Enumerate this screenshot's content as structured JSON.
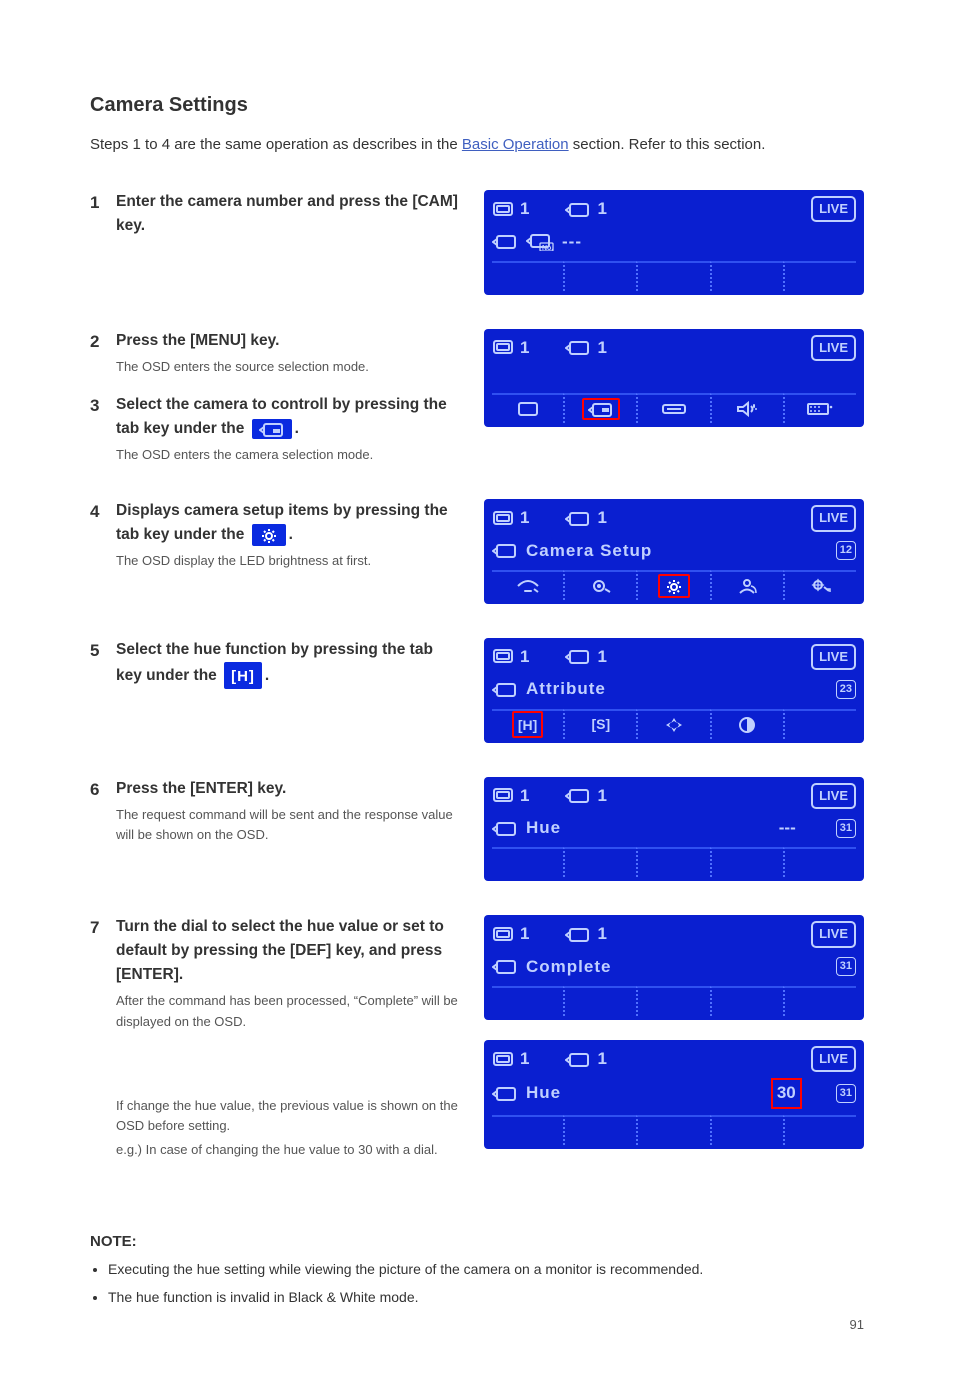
{
  "header": "Camera Settings",
  "intro": {
    "steps": "Steps 1 to 4 are the same operation as describes in the ",
    "link": "Basic Operation",
    "post": " section. Refer to this section."
  },
  "steps": [
    {
      "n": "1",
      "label": "Enter the camera number and press the [CAM] key.",
      "sub": ""
    },
    {
      "n": "2",
      "label": "Press the [MENU] key.",
      "sub": "The OSD enters the source selection mode."
    },
    {
      "n": "3",
      "label": "Select the camera to controll by pressing the tab key under the ",
      "sub": "The OSD enters the camera selection mode.",
      "inlineIcon": "camera"
    },
    {
      "n": "4",
      "label": "Displays camera setup items by pressing the tab key under the ",
      "sub": "The OSD display the LED brightness at first.",
      "inlineIcon": "gear"
    },
    {
      "n": "5",
      "label": "Select the hue function by pressing the tab key under the ",
      "inlineIcon": "H"
    },
    {
      "n": "6",
      "label": "Press the [ENTER] key.",
      "sub": "The request command will be sent and the response value will be shown on the OSD."
    },
    {
      "n": "7",
      "label": "Turn the dial to select the hue value or set to default by pressing the [DEF] key, and press [ENTER].",
      "sub": "After the command has been processed, “Complete” will be displayed on the OSD.",
      "sub2": "If change the hue value, the previous value is shown on the OSD before setting.",
      "sub3": "e.g.) In case of changing the hue value to 30 with a dial."
    }
  ],
  "osd": [
    {
      "top": [
        "mon",
        "1",
        "cam",
        "1",
        "live"
      ],
      "mid": {
        "icons": [
          "cam",
          "camno"
        ],
        "text": "---"
      },
      "bottomCells": [
        "",
        "",
        "",
        "",
        ""
      ]
    },
    {
      "top": [
        "mon",
        "1",
        "cam",
        "1",
        "live"
      ],
      "bottomCells": [
        "mon-ic",
        "cam-ic*",
        "slider-ic",
        "speaker-ic",
        "kb-ic"
      ]
    },
    {
      "top": [
        "mon",
        "1",
        "cam",
        "1",
        "live"
      ],
      "mid": {
        "icons": [
          "cam"
        ],
        "text": "Camera Setup",
        "badge": "12"
      },
      "bottomCells": [
        "bright-ic",
        "focus-ic",
        "gear-ic*",
        "person-ic",
        "spot-ic"
      ]
    },
    {
      "top": [
        "mon",
        "1",
        "cam",
        "1",
        "live"
      ],
      "mid": {
        "icons": [
          "cam"
        ],
        "text": "Attribute",
        "badge": "23"
      },
      "bottomCells": [
        "[H]*",
        "[S]",
        "sparkle-ic",
        "contrast-ic",
        ""
      ]
    },
    {
      "top": [
        "mon",
        "1",
        "cam",
        "1",
        "live"
      ],
      "mid": {
        "icons": [
          "cam"
        ],
        "text": "Hue",
        "val": "---",
        "badge": "31"
      },
      "bottomCells": [
        "",
        "",
        "",
        "",
        ""
      ]
    },
    {
      "top": [
        "mon",
        "1",
        "cam",
        "1",
        "live"
      ],
      "mid": {
        "icons": [
          "cam"
        ],
        "text": "Complete",
        "badge": "31"
      },
      "bottomCells": [
        "",
        "",
        "",
        "",
        ""
      ]
    },
    {
      "top": [
        "mon",
        "1",
        "cam",
        "1",
        "live"
      ],
      "mid": {
        "icons": [
          "cam"
        ],
        "text": "Hue",
        "val": "30",
        "valRed": true,
        "badge": "31"
      },
      "bottomCells": [
        "",
        "",
        "",
        "",
        ""
      ]
    }
  ],
  "note": {
    "title": "NOTE:",
    "items": [
      "Executing the hue setting while viewing the picture of the camera on a monitor is recommended.",
      "The hue function is invalid in Black & White mode."
    ]
  },
  "pageNum": "91"
}
